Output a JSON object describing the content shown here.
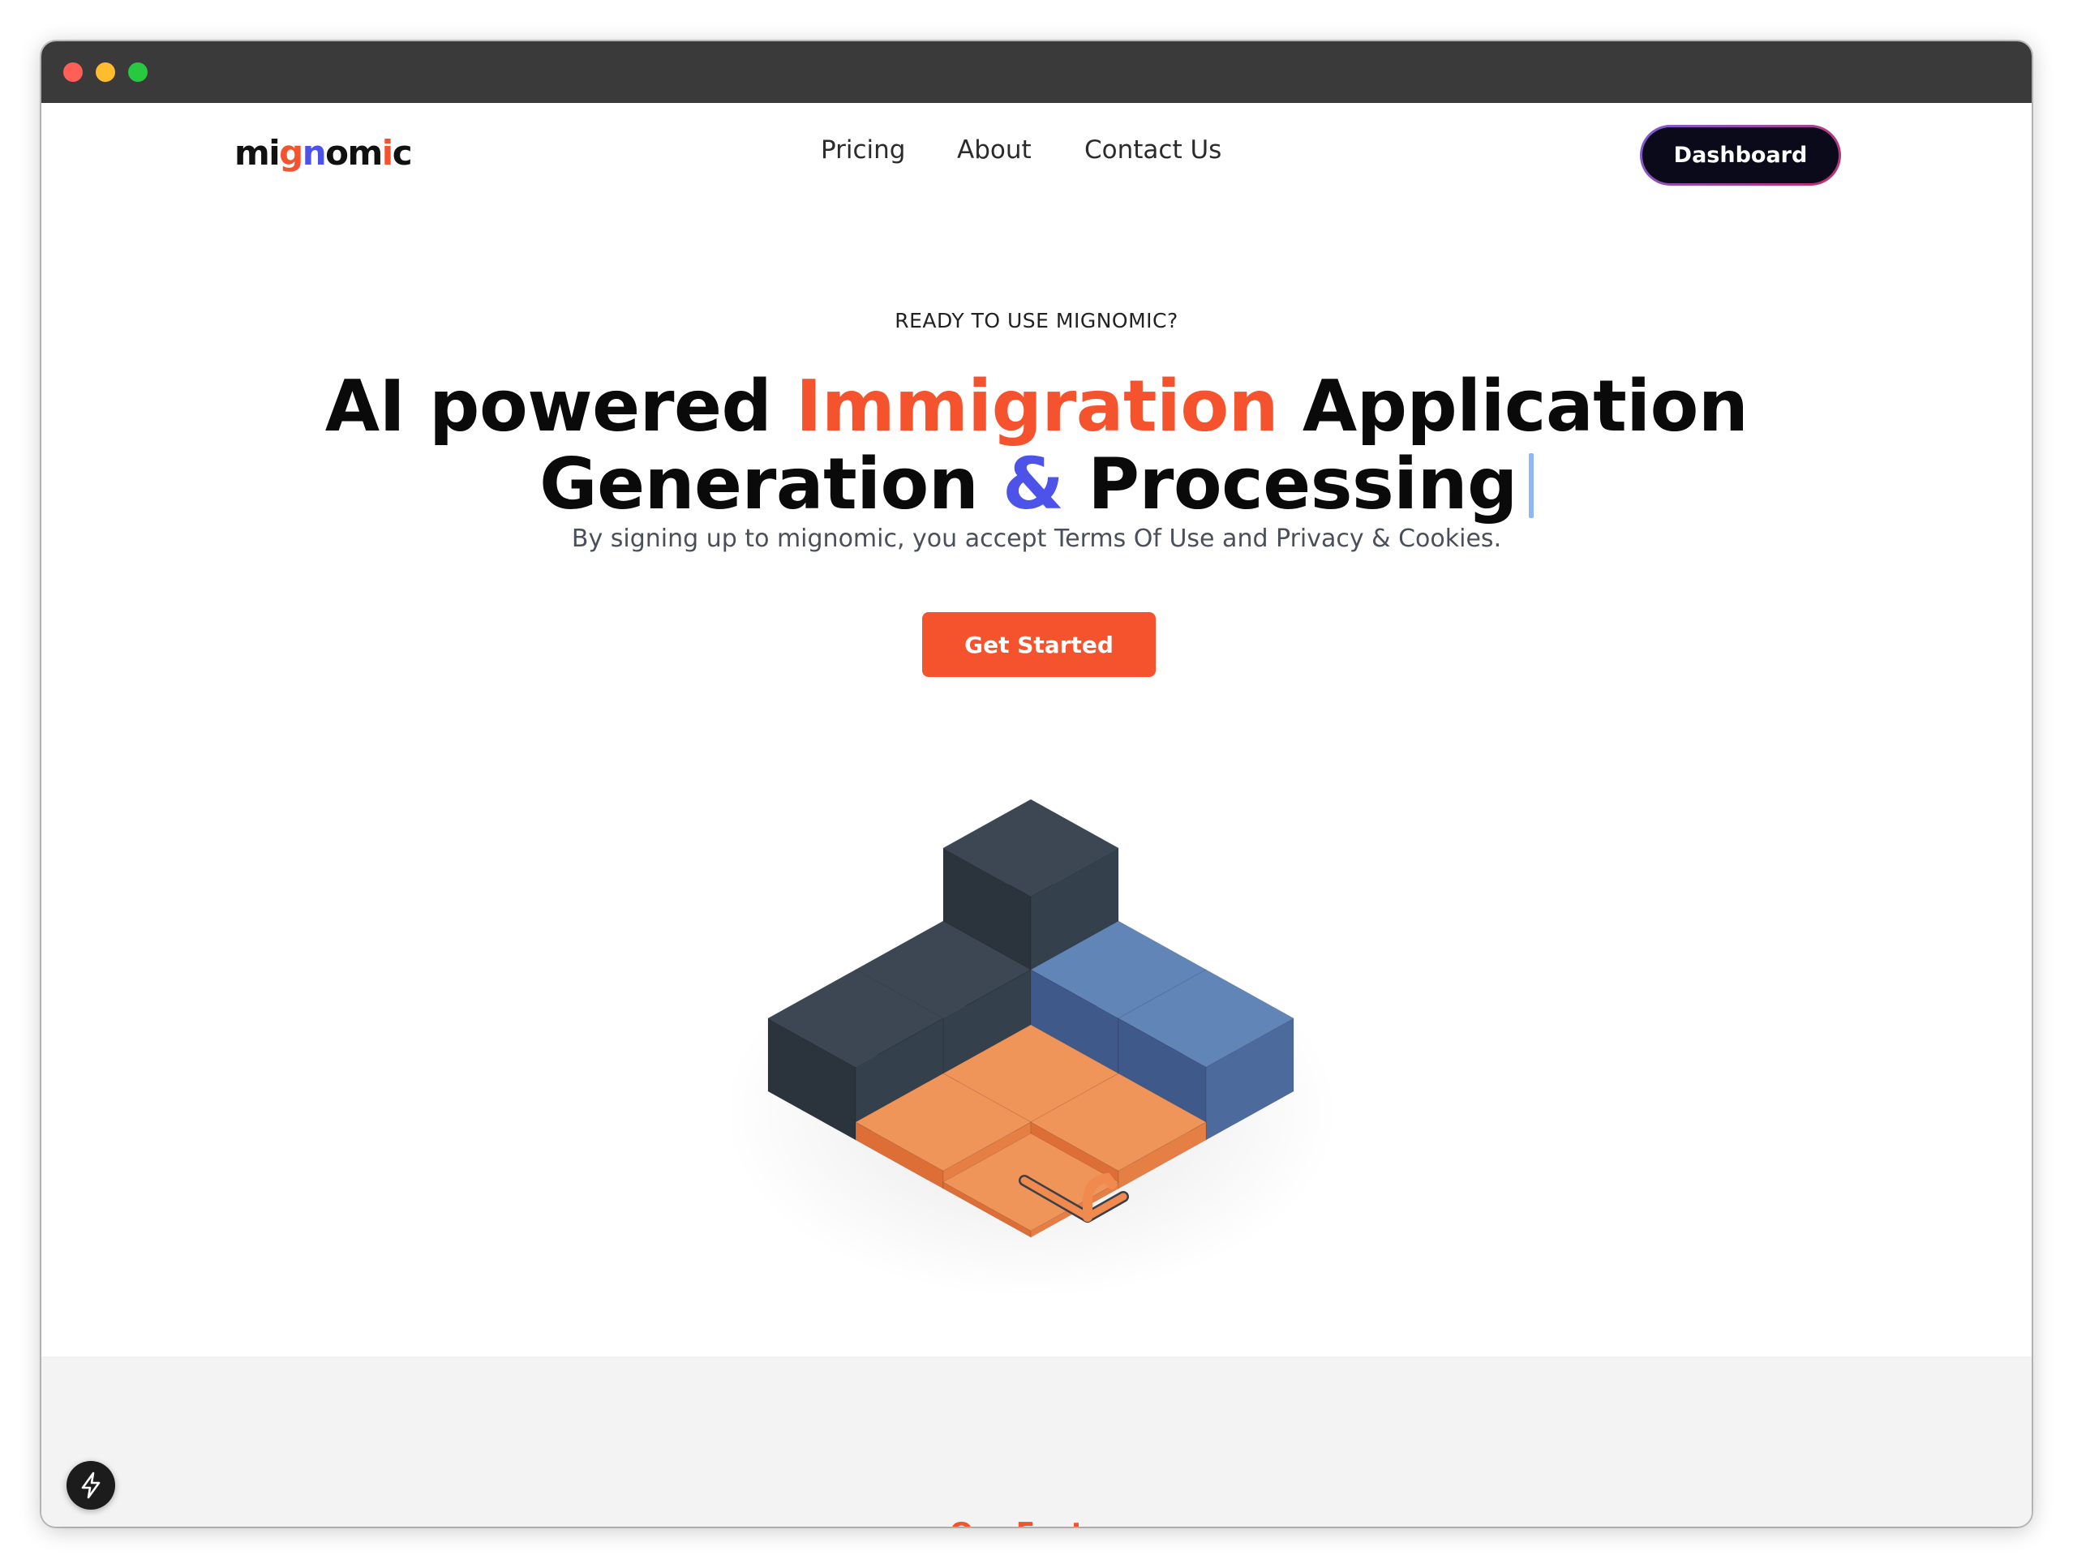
{
  "logo": {
    "letters": [
      {
        "char": "m",
        "color": "#111111"
      },
      {
        "char": "i",
        "color": "#111111"
      },
      {
        "char": "g",
        "color": "#f4532e"
      },
      {
        "char": "n",
        "color": "#4d52e8"
      },
      {
        "char": "o",
        "color": "#111111"
      },
      {
        "char": "m",
        "color": "#111111"
      },
      {
        "char": "i",
        "color": "#f4532e"
      },
      {
        "char": "c",
        "color": "#111111"
      }
    ]
  },
  "nav": {
    "items": [
      {
        "label": "Pricing"
      },
      {
        "label": "About"
      },
      {
        "label": "Contact Us"
      }
    ]
  },
  "header": {
    "dashboard_label": "Dashboard"
  },
  "hero": {
    "eyebrow": "READY TO USE MIGNOMIC?",
    "headline_line1_a": "AI powered ",
    "headline_line1_b": "Immigration",
    "headline_line1_c": " Application",
    "headline_line2_a": "Generation ",
    "headline_line2_b": "&",
    "headline_line2_c": " Processing",
    "subtitle": "By signing up to mignomic, you accept Terms Of Use and Privacy & Cookies.",
    "cta_label": "Get Started"
  },
  "next_section": {
    "peek_text": "Our Features"
  },
  "colors": {
    "accent": "#f4532e",
    "secondary": "#4d52e8",
    "dark": "#0a0a1a",
    "cube_dark": "#36404c",
    "cube_blue": "#5877a6",
    "cube_orange": "#ec8546"
  },
  "icons": {
    "floating_badge": "lightning-bolt-icon",
    "window_controls": [
      "close-dot",
      "minimize-dot",
      "zoom-dot"
    ]
  }
}
